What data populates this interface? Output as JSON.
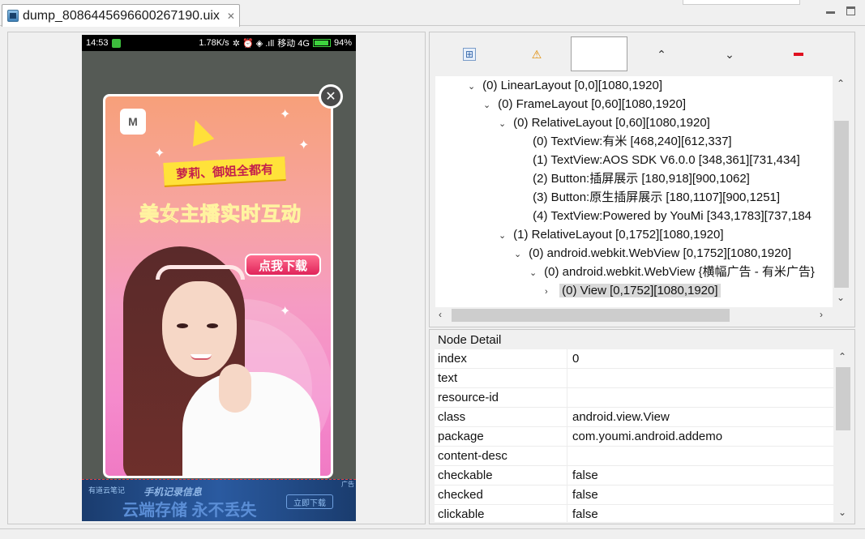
{
  "tab": {
    "title": "dump_8086445696600267190.uix",
    "close": "✕"
  },
  "phone": {
    "status": {
      "time": "14:53",
      "speed": "1.78K/s",
      "icons": "✲ ⏰ ◈ .ıll",
      "carrier": "移动 4G",
      "battery": "94%"
    },
    "ad": {
      "logo": "M",
      "banner": "萝莉、御姐全都有",
      "headline": "美女主播实时互动",
      "download": "点我下载",
      "close": "✕"
    },
    "bottom_banner": {
      "brand": "有道云笔记",
      "tagline": "手机记录信息",
      "slogan": "云端存储 永不丢失",
      "cta": "立即下载",
      "ad_tag": "广告"
    }
  },
  "toolbar": {
    "up": "⌃",
    "down": "⌄",
    "warn": "⚠",
    "expand": "⊞"
  },
  "tree": {
    "nodes": [
      {
        "text": "(0) LinearLayout [0,0][1080,1920]",
        "twisty": "⌄"
      },
      {
        "text": "(0) FrameLayout [0,60][1080,1920]",
        "twisty": "⌄"
      },
      {
        "text": "(0) RelativeLayout [0,60][1080,1920]",
        "twisty": "⌄"
      },
      {
        "text": "(0) TextView:有米 [468,240][612,337]",
        "twisty": ""
      },
      {
        "text": "(1) TextView:AOS SDK V6.0.0 [348,361][731,434]",
        "twisty": ""
      },
      {
        "text": "(2) Button:插屏展示 [180,918][900,1062]",
        "twisty": ""
      },
      {
        "text": "(3) Button:原生插屏展示 [180,1107][900,1251]",
        "twisty": ""
      },
      {
        "text": "(4) TextView:Powered by YouMi [343,1783][737,184",
        "twisty": ""
      },
      {
        "text": "(1) RelativeLayout [0,1752][1080,1920]",
        "twisty": "⌄"
      },
      {
        "text": "(0) android.webkit.WebView [0,1752][1080,1920]",
        "twisty": "⌄"
      },
      {
        "text": "(0) android.webkit.WebView {横幅广告 - 有米广告}",
        "twisty": "⌄"
      },
      {
        "text": "(0) View [0,1752][1080,1920]",
        "twisty": "›"
      }
    ],
    "scroll": {
      "up": "⌃",
      "down": "⌄",
      "left": "‹",
      "right": "›"
    }
  },
  "detail": {
    "title": "Node Detail",
    "rows": [
      {
        "key": "index",
        "value": "0"
      },
      {
        "key": "text",
        "value": ""
      },
      {
        "key": "resource-id",
        "value": ""
      },
      {
        "key": "class",
        "value": "android.view.View"
      },
      {
        "key": "package",
        "value": "com.youmi.android.addemo"
      },
      {
        "key": "content-desc",
        "value": ""
      },
      {
        "key": "checkable",
        "value": "false"
      },
      {
        "key": "checked",
        "value": "false"
      },
      {
        "key": "clickable",
        "value": "false"
      }
    ],
    "scroll": {
      "up": "⌃",
      "down": "⌄"
    }
  }
}
